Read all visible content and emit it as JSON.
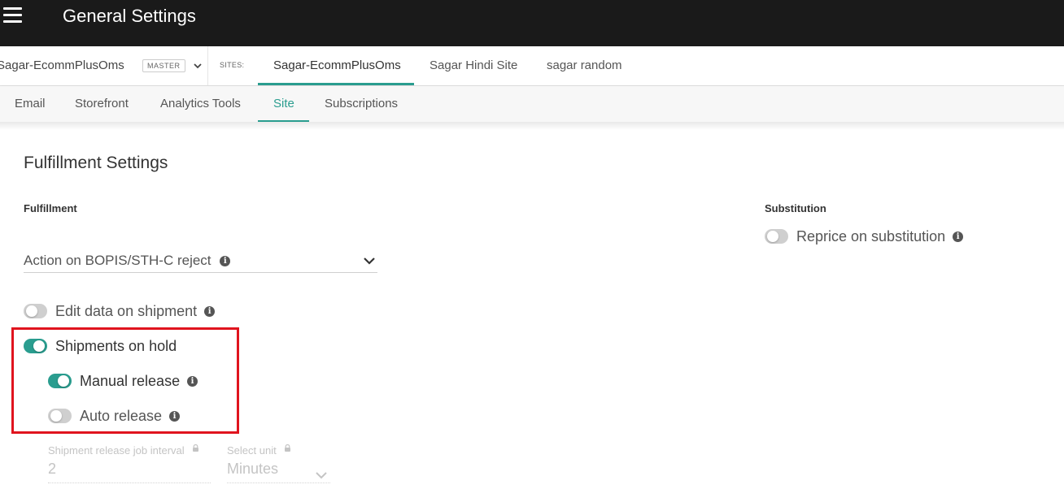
{
  "header": {
    "title": "General Settings"
  },
  "sitebar": {
    "tenant": "Sagar-EcommPlusOms",
    "badge": "MASTER",
    "sites_label": "SITES:",
    "sites": [
      "Sagar-EcommPlusOms",
      "Sagar Hindi Site",
      "sagar random"
    ],
    "active_site": "Sagar-EcommPlusOms"
  },
  "tabs": {
    "items": [
      "Email",
      "Storefront",
      "Analytics Tools",
      "Site",
      "Subscriptions"
    ],
    "active": "Site"
  },
  "content": {
    "title": "Fulfillment Settings",
    "fulfillment_label": "Fulfillment",
    "substitution_label": "Substitution",
    "reject_action": {
      "placeholder": "Action on BOPIS/STH-C reject"
    },
    "toggles": {
      "edit_data": {
        "label": "Edit data on shipment",
        "checked": false
      },
      "shipments_on_hold": {
        "label": "Shipments on hold",
        "checked": true
      },
      "manual_release": {
        "label": "Manual release",
        "checked": true
      },
      "auto_release": {
        "label": "Auto release",
        "checked": false
      },
      "reprice": {
        "label": "Reprice on substitution",
        "checked": false
      }
    },
    "job_interval": {
      "label": "Shipment release job interval",
      "value": "2"
    },
    "unit": {
      "label": "Select unit",
      "value": "Minutes"
    }
  },
  "colors": {
    "accent": "#2a9d8f",
    "header_bg": "#1a1a1a",
    "highlight": "#e0141e"
  },
  "icons": [
    "hamburger-menu-icon",
    "chevron-down-icon",
    "info-icon",
    "lock-icon"
  ]
}
